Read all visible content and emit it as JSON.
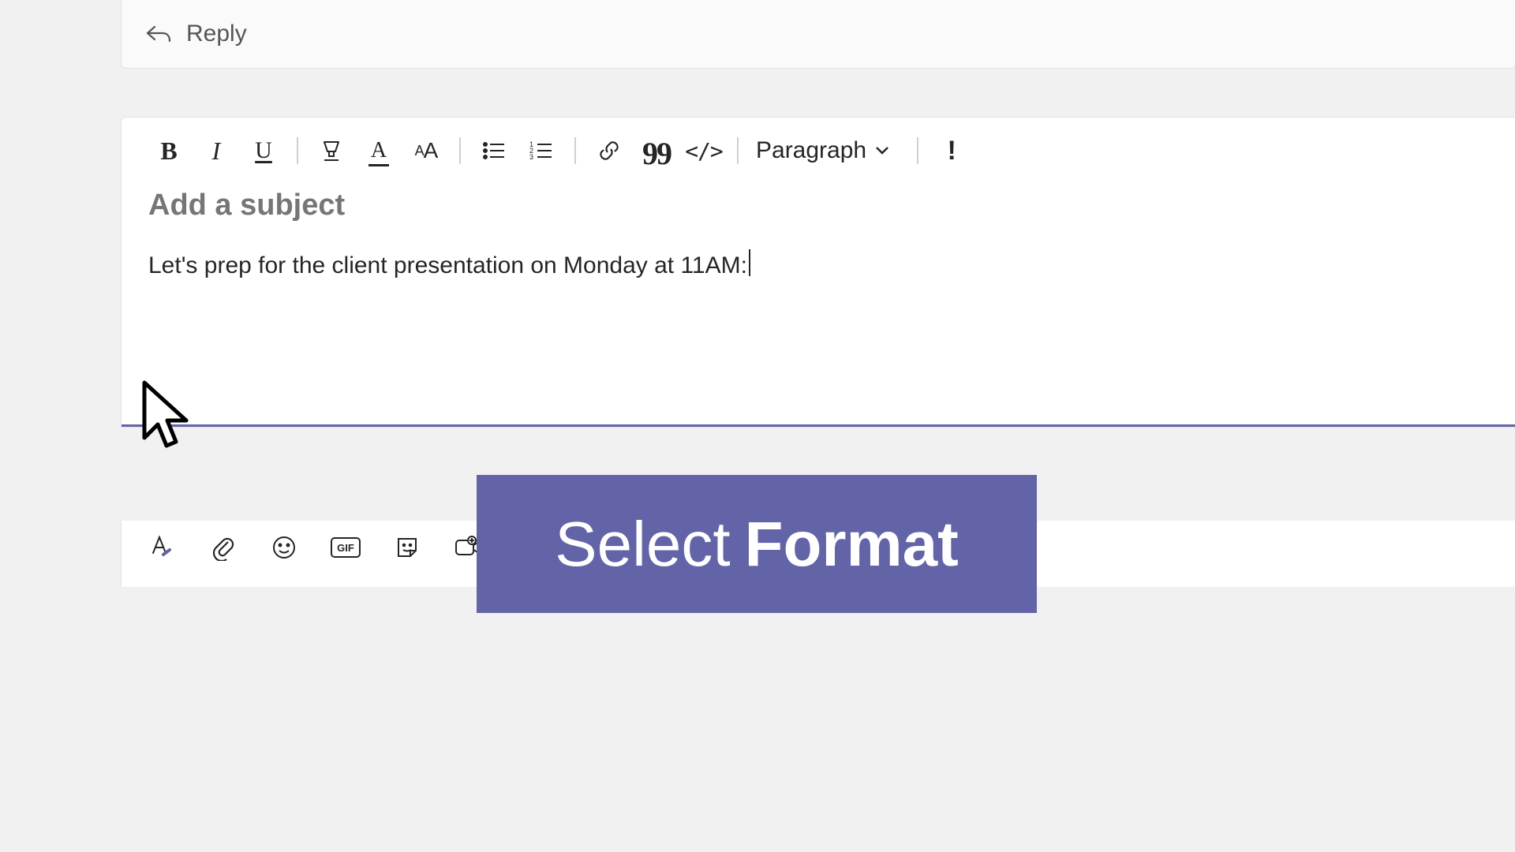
{
  "reply": {
    "label": "Reply"
  },
  "toolbar": {
    "bold": "B",
    "italic": "I",
    "underline": "U",
    "font_color_letter": "A",
    "font_size_big": "A",
    "font_size_small": "A",
    "quote": "99",
    "code": "</>",
    "paragraph_label": "Paragraph",
    "importance": "!"
  },
  "compose": {
    "subject_placeholder": "Add a subject",
    "body_text": "Let's prep for the client presentation on Monday at 11AM:"
  },
  "bottom": {
    "gif_label": "GIF"
  },
  "callout": {
    "word1": "Select",
    "word2": "Format"
  }
}
